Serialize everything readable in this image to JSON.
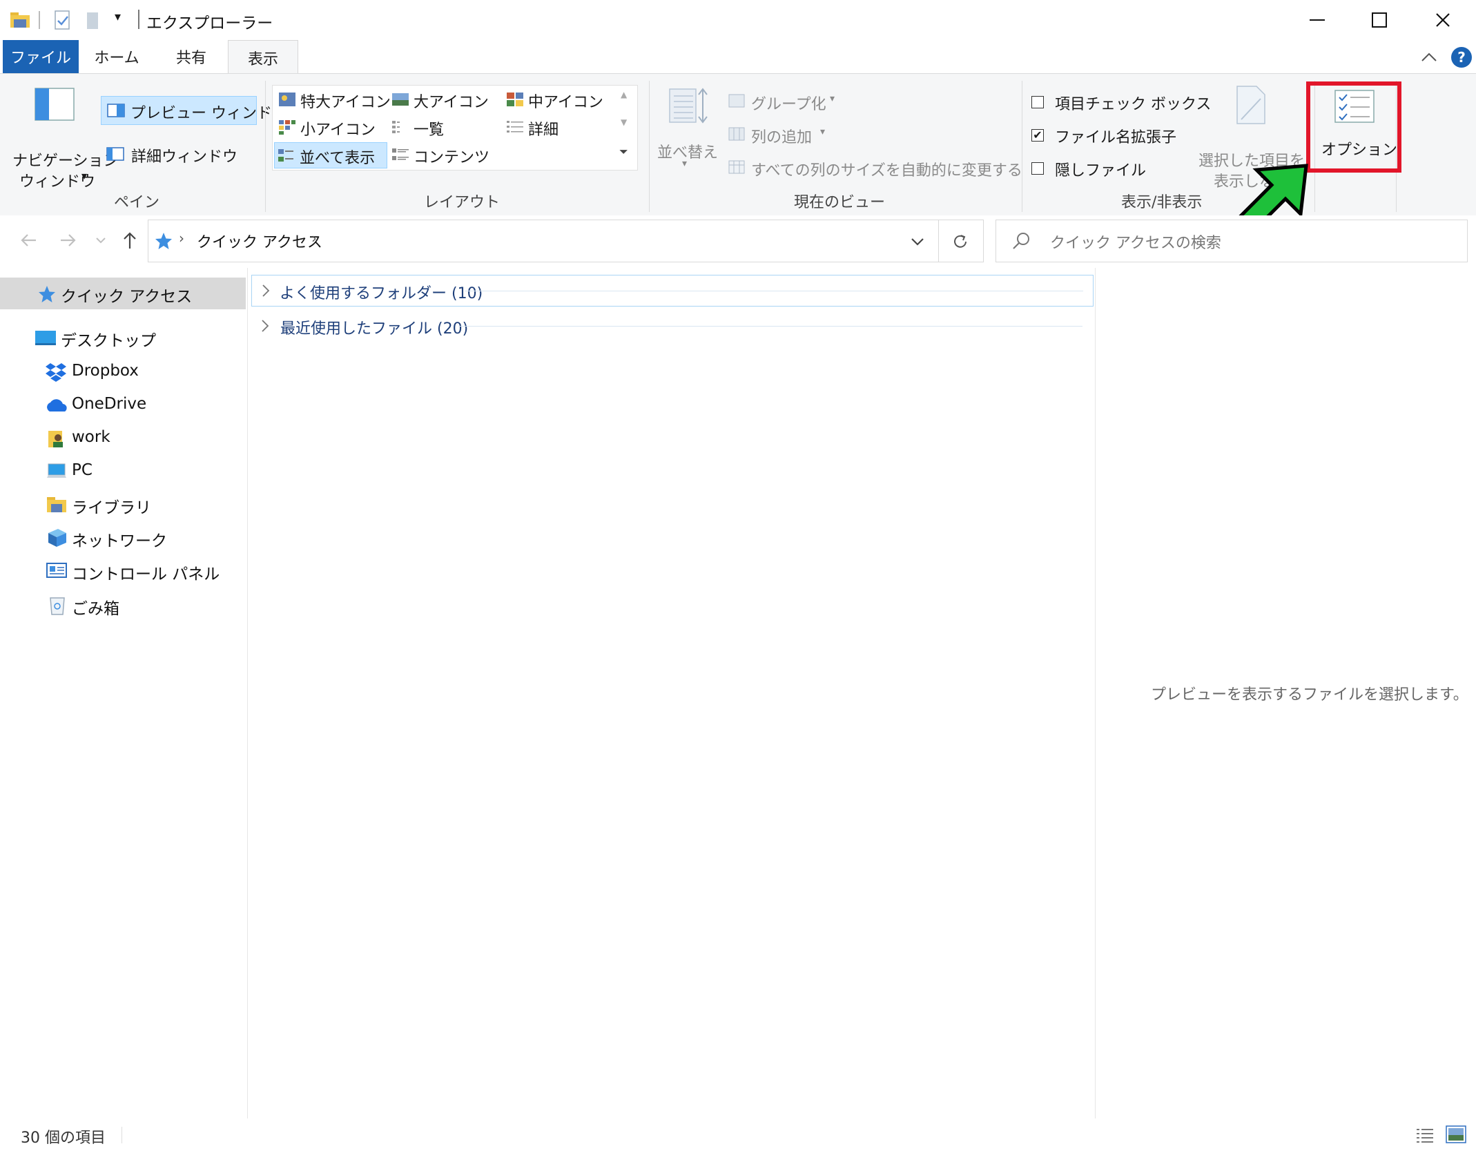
{
  "window": {
    "title": "エクスプローラー",
    "minimize_glyph": "—",
    "maximize_glyph": "☐",
    "close_glyph": "✕"
  },
  "tabs": [
    {
      "label": "ファイル"
    },
    {
      "label": "ホーム"
    },
    {
      "label": "共有"
    },
    {
      "label": "表示"
    }
  ],
  "ribbon": {
    "pane_group": {
      "label": "ペイン",
      "nav_pane": "ナビゲーション\nウィンドウ",
      "nav_pane_line1": "ナビゲーション",
      "nav_pane_line2": "ウィンドウ",
      "preview_pane": "プレビュー ウィンドウ",
      "details_pane": "詳細ウィンドウ"
    },
    "layout_group": {
      "label": "レイアウト",
      "items": [
        {
          "label": "特大アイコン",
          "selected": false
        },
        {
          "label": "大アイコン",
          "selected": false
        },
        {
          "label": "中アイコン",
          "selected": false
        },
        {
          "label": "小アイコン",
          "selected": false
        },
        {
          "label": "一覧",
          "selected": false
        },
        {
          "label": "詳細",
          "selected": false
        },
        {
          "label": "並べて表示",
          "selected": true
        },
        {
          "label": "コンテンツ",
          "selected": false
        }
      ]
    },
    "current_view_group": {
      "label": "現在のビュー",
      "sort_line1": "並べ替え",
      "group_by": "グループ化",
      "add_columns": "列の追加",
      "size_all_columns": "すべての列のサイズを自動的に変更する"
    },
    "show_hide_group": {
      "label": "表示/非表示",
      "item_checkboxes": {
        "label": "項目チェック ボックス",
        "checked": false
      },
      "file_extensions": {
        "label": "ファイル名拡張子",
        "checked": true
      },
      "hidden_items": {
        "label": "隠しファイル",
        "checked": false
      },
      "hide_selected_line1": "選択した項目を",
      "hide_selected_line2": "表示しない"
    },
    "options": {
      "label": "オプション"
    }
  },
  "address": {
    "breadcrumb": "クイック アクセス",
    "search_placeholder": "クイック アクセスの検索"
  },
  "nav": {
    "items": [
      {
        "label": "クイック アクセス",
        "icon": "star-icon",
        "selected": true
      },
      {
        "label": "デスクトップ",
        "icon": "desktop-icon"
      },
      {
        "label": "Dropbox",
        "icon": "dropbox-icon"
      },
      {
        "label": "OneDrive",
        "icon": "onedrive-icon"
      },
      {
        "label": "work",
        "icon": "user-folder-icon"
      },
      {
        "label": "PC",
        "icon": "pc-icon"
      },
      {
        "label": "ライブラリ",
        "icon": "library-icon"
      },
      {
        "label": "ネットワーク",
        "icon": "network-icon"
      },
      {
        "label": "コントロール パネル",
        "icon": "control-panel-icon"
      },
      {
        "label": "ごみ箱",
        "icon": "recycle-bin-icon"
      }
    ]
  },
  "content": {
    "groups": [
      {
        "label": "よく使用するフォルダー (10)"
      },
      {
        "label": "最近使用したファイル (20)"
      }
    ]
  },
  "preview": {
    "message": "プレビューを表示するファイルを選択します。"
  },
  "status": {
    "item_count": "30 個の項目"
  },
  "colors": {
    "file_tab": "#1b63b4",
    "highlight_box": "#e2162a",
    "arrow": "#1ec03a",
    "selection": "#cce8ff"
  }
}
